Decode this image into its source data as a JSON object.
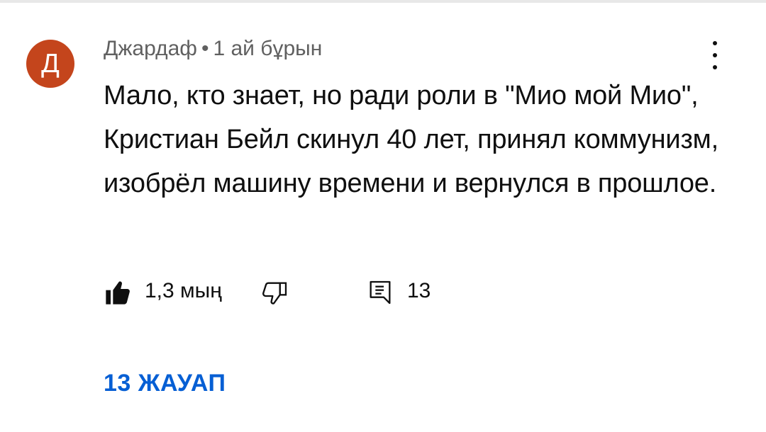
{
  "comment": {
    "avatar_letter": "Д",
    "avatar_color": "#c4451c",
    "author": "Джардаф",
    "separator": "•",
    "time": "1 ай бұрын",
    "text": "Мало, кто знает, но ради роли в \"Мио мой Мио\", Кристиан Бейл скинул 40 лет, принял коммунизм, изобрёл машину времени и вернулся в прошлое.",
    "menu_icon": "more-vert-icon"
  },
  "actions": {
    "like_icon": "thumbs-up-filled-icon",
    "like_count": "1,3 мың",
    "dislike_icon": "thumbs-down-outline-icon",
    "reply_icon": "comment-icon",
    "reply_count": "13"
  },
  "replies": {
    "label": "13 ЖАУАП",
    "color": "#065fd4"
  }
}
